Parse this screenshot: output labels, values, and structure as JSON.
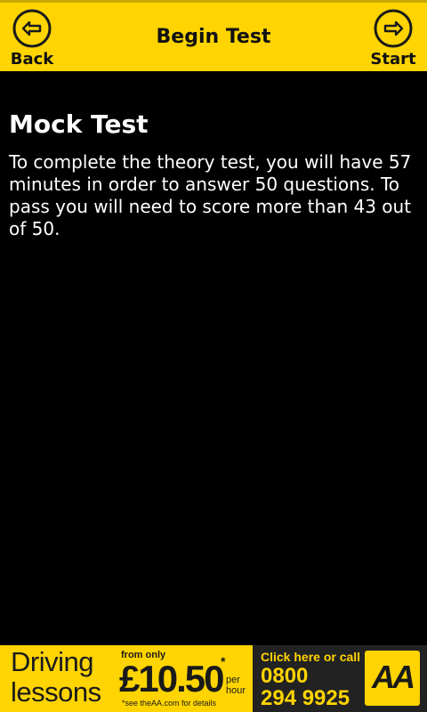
{
  "header": {
    "title": "Begin Test",
    "back_label": "Back",
    "start_label": "Start",
    "back_icon": "back-arrow-icon",
    "start_icon": "forward-arrow-icon"
  },
  "content": {
    "heading": "Mock Test",
    "body": "To complete the theory test, you will have 57 minutes in order to answer 50 questions. To pass you will need to score more than 43 out of 50."
  },
  "ad": {
    "line1": "Driving",
    "line2": "lessons",
    "from_only": "from only",
    "price": "£10.50",
    "asterisk": "*",
    "per_hour_1": "per",
    "per_hour_2": "hour",
    "see_details": "*see theAA.com for details",
    "call_text": "Click here or call",
    "phone_1": "0800",
    "phone_2": "294 9925",
    "logo_text": "AA"
  },
  "colors": {
    "brand_yellow": "#ffd400",
    "background": "#000000",
    "text": "#ffffff"
  }
}
